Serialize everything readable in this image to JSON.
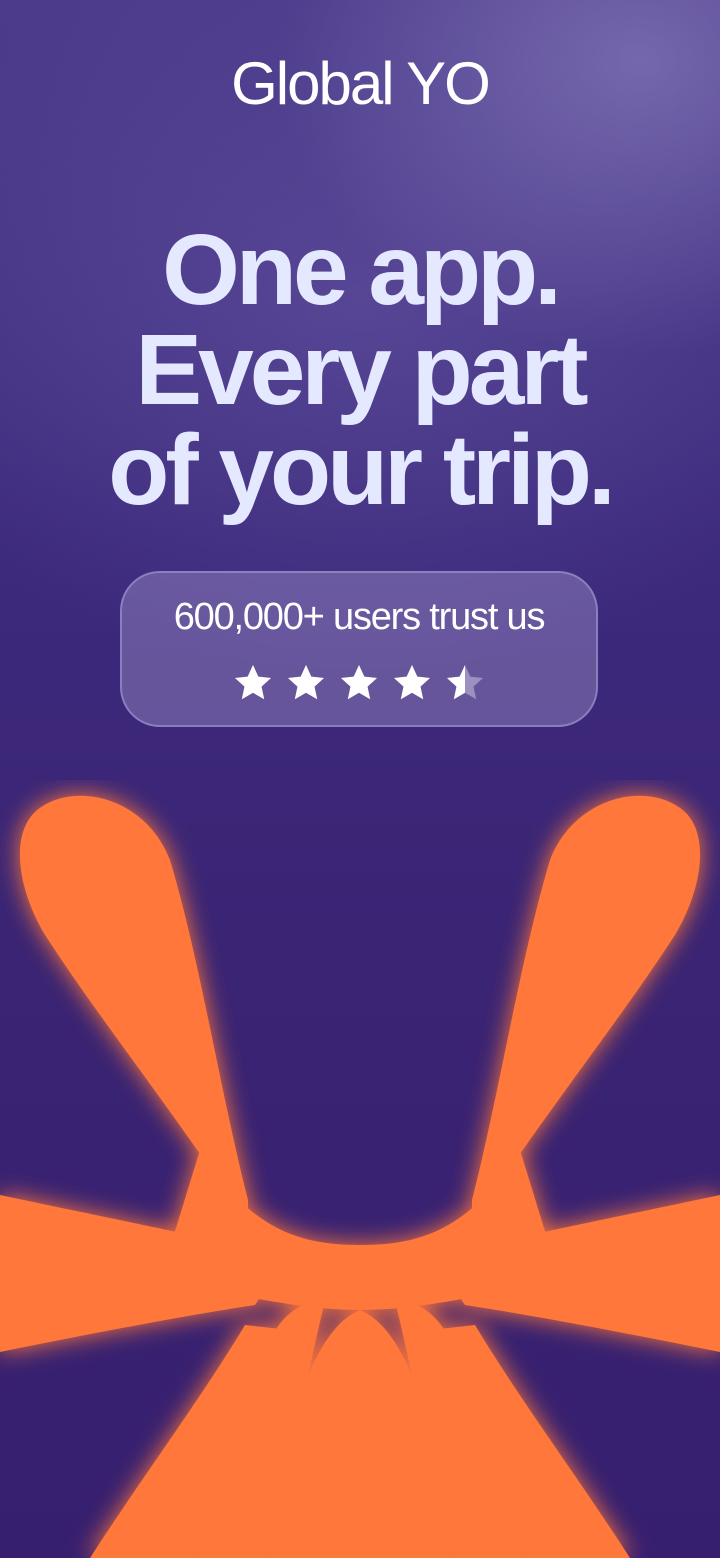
{
  "brand": {
    "logo_text": "Global YO"
  },
  "hero": {
    "headline_lines": [
      "One app.",
      "Every part",
      "of your trip."
    ]
  },
  "trust": {
    "text": "600,000+ users trust us",
    "rating": 4.5,
    "rating_max": 5
  },
  "icons": {
    "star": "star-icon",
    "graphic": "asterisk-graphic"
  },
  "colors": {
    "background": "#3a2474",
    "accent": "#ff773b",
    "headline": "#e4e9ff",
    "star": "#ffffff"
  }
}
